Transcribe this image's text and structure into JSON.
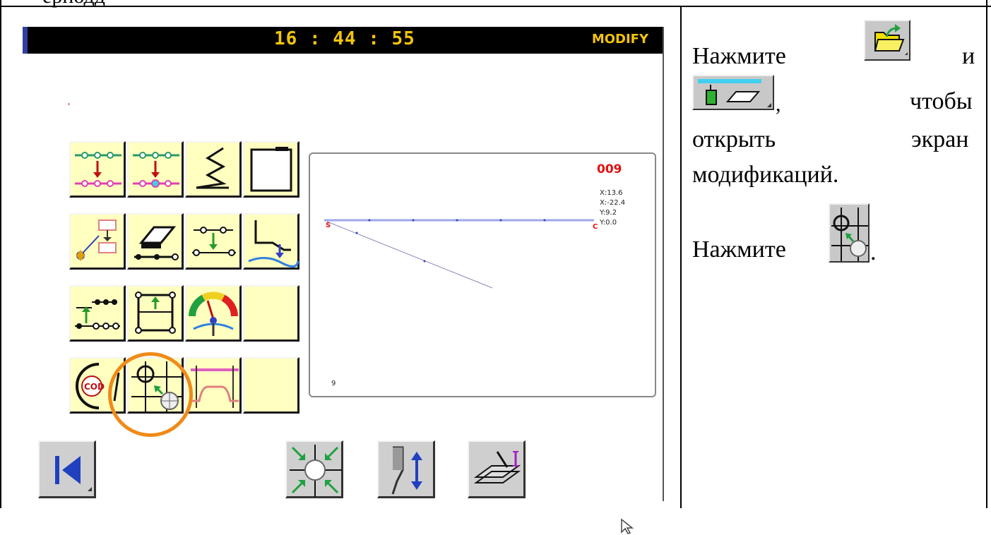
{
  "header": {
    "top_hint": "ерподд",
    "time": "16 : 44 : 55",
    "mode": "MODIFY"
  },
  "preview": {
    "number": "009",
    "coords": [
      "X:13.6",
      "X:-22.4",
      "Y:9.2",
      "Y:0.0"
    ],
    "start_marker": "S",
    "end_marker": "C",
    "stitch_count": "9"
  },
  "buttons": {
    "row1": [
      "move-point-up-icon",
      "move-point-alt-icon",
      "zigzag-icon",
      "frame-corner-icon"
    ],
    "row2": [
      "flowchart-icon",
      "erase-point-icon",
      "shift-point-icon",
      "presser-adjust-icon"
    ],
    "row3": [
      "multi-point-move-icon",
      "block-move-icon",
      "speed-gauge-icon",
      "empty"
    ],
    "row4": [
      "code-icon",
      "circle-arc-icon",
      "pink-frame-icon",
      "empty"
    ],
    "highlighted": "circle-arc-icon"
  },
  "bottom_toolbar": [
    "back-to-start-icon",
    "zoom-center-icon",
    "needle-updown-icon",
    "presser-foot-icon"
  ],
  "instructions": {
    "line1_word": "Нажмите",
    "line1_and": "и",
    "line2_word": "чтобы",
    "line3_a": "открыть",
    "line3_b": "экран",
    "line4": "модификаций.",
    "line5_word": "Нажмите",
    "line5_end": ".",
    "comma": ","
  },
  "colors": {
    "button_bg": "#ffffc0",
    "clock": "#f2c40c",
    "highlight": "#f08a18",
    "preview_number": "#e01010"
  }
}
